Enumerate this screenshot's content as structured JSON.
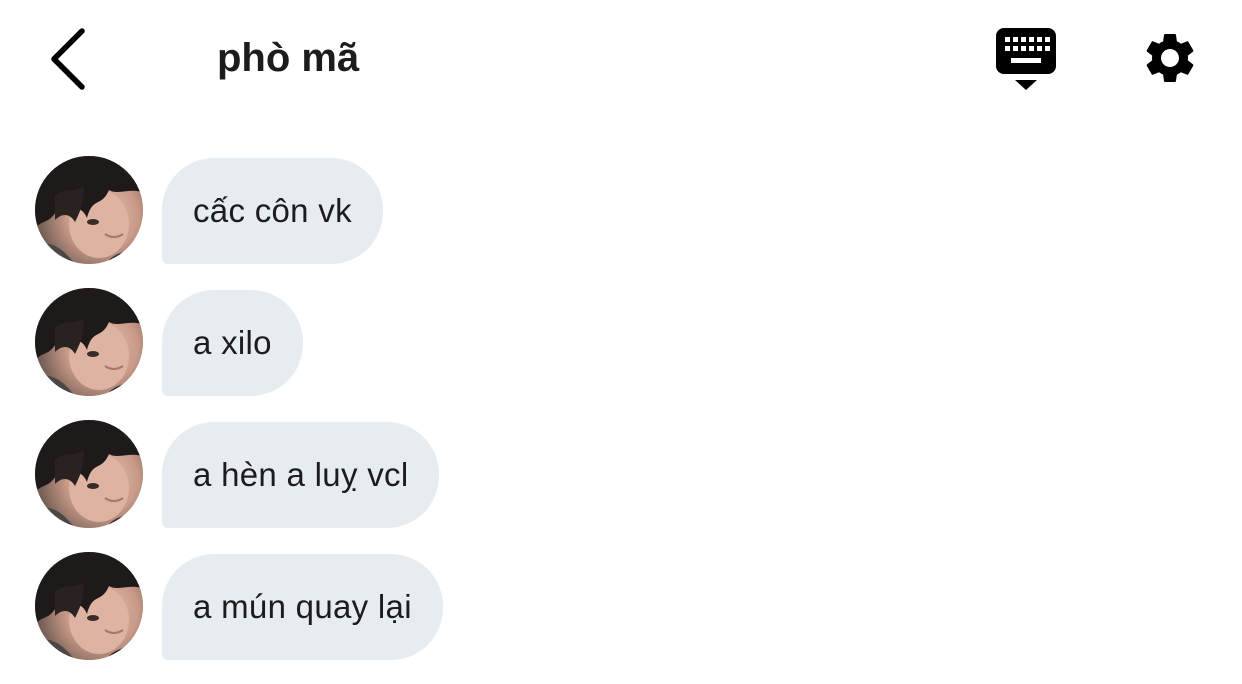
{
  "header": {
    "title": "phò mã",
    "back_icon": "chevron-left-icon",
    "keyboard_icon": "keyboard-icon",
    "settings_icon": "gear-icon"
  },
  "colors": {
    "bubble_bg": "#e7ecf0",
    "text": "#1c1c1e",
    "icon": "#000000"
  },
  "messages": [
    {
      "text": "cấc côn vk"
    },
    {
      "text": "a xilo"
    },
    {
      "text": "a hèn a luỵ vcl"
    },
    {
      "text": "a mún quay lại"
    }
  ]
}
